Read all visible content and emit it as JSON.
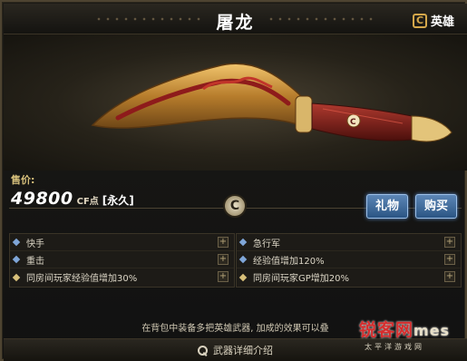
{
  "window": {
    "title": "屠龙"
  },
  "rank": {
    "icon": "hero-rank-icon",
    "icon_glyph": "C",
    "label": "英雄"
  },
  "weapon": {
    "icon": "kukri-knife-image",
    "accent": "#8b1b1b",
    "gold": "#c89a3e"
  },
  "price": {
    "label": "售价:",
    "value": "49800",
    "unit": "CF点",
    "term": "[永久]"
  },
  "emblem": {
    "icon": "crossfire-emblem-icon",
    "glyph": "C"
  },
  "buttons": {
    "gift": "礼物",
    "buy": "购买"
  },
  "attributes": {
    "left": [
      {
        "text": "快手",
        "marker": "blue"
      },
      {
        "text": "重击",
        "marker": "blue"
      },
      {
        "text": "同房间玩家经验值增加30%",
        "marker": "gold"
      }
    ],
    "right": [
      {
        "text": "急行军",
        "marker": "blue"
      },
      {
        "text": "经验值增加120%",
        "marker": "blue"
      },
      {
        "text": "同房间玩家GP增加20%",
        "marker": "gold"
      }
    ]
  },
  "notice": "在背包中装备多把英雄武器, 加成的效果可以叠",
  "footer": {
    "label": "武器详细介绍",
    "icon": "search-icon"
  },
  "watermark": {
    "main": "锐客网",
    "latin": "mes",
    "sub": "太平洋游戏网"
  }
}
